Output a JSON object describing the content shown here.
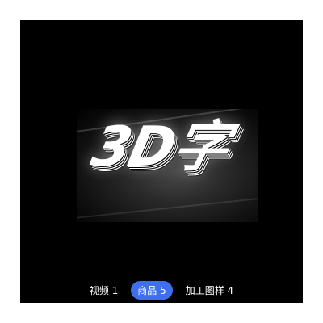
{
  "media": {
    "title_text": "3D字"
  },
  "tabs": [
    {
      "label": "视频 1",
      "active": false
    },
    {
      "label": "商品 5",
      "active": true
    },
    {
      "label": "加工图样 4",
      "active": false
    }
  ],
  "colors": {
    "viewer_background": "#000000",
    "active_tab": "#3d6ff0",
    "tab_text": "#ffffff"
  }
}
